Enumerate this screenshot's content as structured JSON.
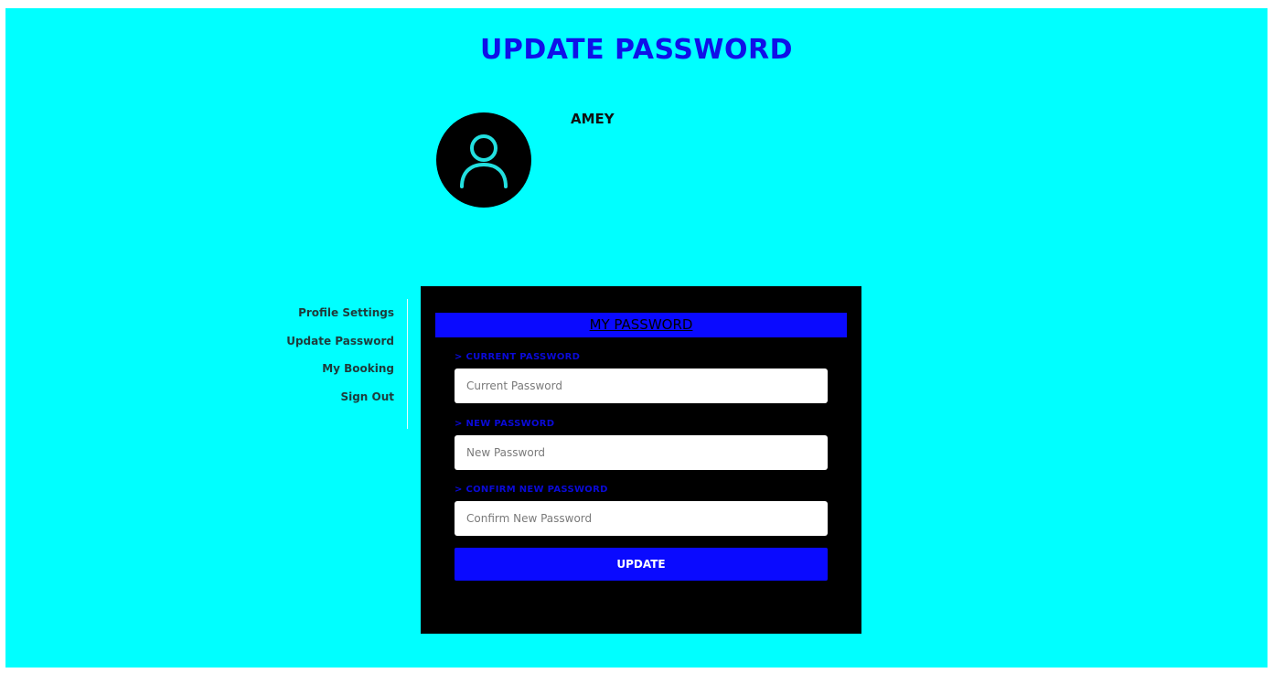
{
  "page": {
    "title": "UPDATE PASSWORD"
  },
  "profile": {
    "name": "AMEY",
    "avatar_icon": "user-icon"
  },
  "sidebar": {
    "items": [
      {
        "label": "Profile Settings"
      },
      {
        "label": "Update Password"
      },
      {
        "label": "My Booking"
      },
      {
        "label": "Sign Out"
      }
    ]
  },
  "form": {
    "header": "MY PASSWORD",
    "fields": [
      {
        "label": "> CURRENT PASSWORD",
        "placeholder": "Current Password",
        "value": ""
      },
      {
        "label": "> NEW PASSWORD",
        "placeholder": "New Password",
        "value": ""
      },
      {
        "label": "> CONFIRM NEW PASSWORD",
        "placeholder": "Confirm New Password",
        "value": ""
      }
    ],
    "submit_label": "UPDATE"
  },
  "colors": {
    "background": "#00ffff",
    "accent": "#0a0aff",
    "panel": "#000000"
  }
}
